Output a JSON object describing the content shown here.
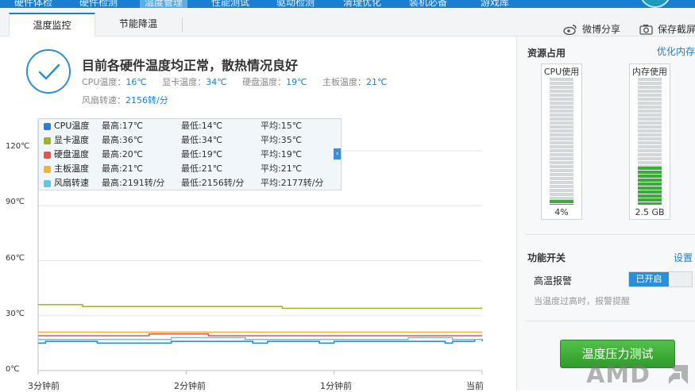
{
  "top_nav": {
    "items": [
      "硬件体检",
      "硬件检测",
      "温度管理",
      "性能测试",
      "驱动检测",
      "清理优化",
      "装机必备",
      "游戏库"
    ],
    "active_index": 2
  },
  "tabs": [
    {
      "label": "温度监控",
      "active": true
    },
    {
      "label": "节能降温",
      "active": false
    }
  ],
  "share": {
    "weibo_label": "微博分享",
    "screenshot_label": "保存截屏"
  },
  "status": {
    "title": "目前各硬件温度均正常，散热情况良好",
    "cpu_label": "CPU温度：",
    "cpu_value": "16℃",
    "gpu_label": "显卡温度：",
    "gpu_value": "34℃",
    "disk_label": "硬盘温度：",
    "disk_value": "19℃",
    "board_label": "主板温度：",
    "board_value": "21℃",
    "fan_label": "风扇转速：",
    "fan_value": "2156转/分"
  },
  "chart_data": {
    "type": "line",
    "y_tick_labels": [
      "120℃",
      "90℃",
      "60℃",
      "30℃",
      "0℃"
    ],
    "ylim": [
      0,
      120
    ],
    "x_tick_labels": [
      "3分钟前",
      "2分钟前",
      "1分钟前",
      "当前"
    ],
    "xlim": [
      -3,
      0
    ],
    "grid": true,
    "legend": [
      {
        "name": "CPU温度",
        "max": "最高:17℃",
        "min": "最低:14℃",
        "avg": "平均:15℃",
        "color": "#2b7fd6"
      },
      {
        "name": "显卡温度",
        "max": "最高:36℃",
        "min": "最低:34℃",
        "avg": "平均:35℃",
        "color": "#a0b21e"
      },
      {
        "name": "硬盘温度",
        "max": "最高:20℃",
        "min": "最低:19℃",
        "avg": "平均:19℃",
        "color": "#e8514a"
      },
      {
        "name": "主板温度",
        "max": "最高:21℃",
        "min": "最低:21℃",
        "avg": "平均:21℃",
        "color": "#f2b33d"
      },
      {
        "name": "风扇转速",
        "max": "最高:2191转/分",
        "min": "最低:2156转/分",
        "avg": "平均:2177转/分",
        "color": "#5bc8ea"
      }
    ],
    "series": [
      {
        "name": "CPU温度",
        "color": "#2b7fd6",
        "points": [
          [
            -3,
            15
          ],
          [
            -2.95,
            16
          ],
          [
            -2.7,
            16
          ],
          [
            -2.6,
            15
          ],
          [
            -2.2,
            15
          ],
          [
            -2.1,
            16
          ],
          [
            -1.6,
            16
          ],
          [
            -1.55,
            15
          ],
          [
            -1.5,
            15
          ],
          [
            -1.45,
            16
          ],
          [
            -1.2,
            16
          ],
          [
            -1.1,
            15
          ],
          [
            -1.0,
            16
          ],
          [
            -0.3,
            16
          ],
          [
            -0.25,
            15
          ],
          [
            -0.2,
            16
          ],
          [
            -0.1,
            16
          ],
          [
            -0.05,
            17
          ],
          [
            0,
            16
          ]
        ]
      },
      {
        "name": "显卡温度",
        "color": "#a0b21e",
        "points": [
          [
            -3,
            36
          ],
          [
            -2.75,
            36
          ],
          [
            -2.7,
            35
          ],
          [
            -1.4,
            35
          ],
          [
            -1.35,
            34
          ],
          [
            0,
            34
          ]
        ]
      },
      {
        "name": "硬盘温度",
        "color": "#e8514a",
        "points": [
          [
            -3,
            19
          ],
          [
            -2.3,
            19
          ],
          [
            -2.25,
            20
          ],
          [
            -1.9,
            20
          ],
          [
            -1.85,
            19
          ],
          [
            0,
            19
          ]
        ]
      },
      {
        "name": "主板温度",
        "color": "#f2b33d",
        "points": [
          [
            -3,
            21
          ],
          [
            0,
            21
          ]
        ]
      },
      {
        "name": "风扇转速",
        "color": "#5bc8ea",
        "points": [
          [
            -3,
            17
          ],
          [
            -2.2,
            17
          ],
          [
            -2.1,
            18
          ],
          [
            -1.7,
            18
          ],
          [
            -1.6,
            17
          ],
          [
            -0.6,
            17
          ],
          [
            -0.5,
            18
          ],
          [
            -0.3,
            18
          ],
          [
            -0.2,
            17
          ],
          [
            0,
            17
          ]
        ]
      }
    ]
  },
  "sidebar": {
    "resource_title": "资源占用",
    "optimize_link": "优化内存",
    "cpu_meter": {
      "label": "CPU使用",
      "value": "4%",
      "fill_fraction": 0.04
    },
    "mem_meter": {
      "label": "内存使用",
      "value": "2.5 GB",
      "fill_fraction": 0.3
    },
    "feature_title": "功能开关",
    "settings_link": "设置",
    "alarm_label": "高温报警",
    "alarm_state": "已开启",
    "alarm_hint": "当温度过高时，报警提醒",
    "stress_button": "温度压力测试"
  },
  "watermark": {
    "logo_text": "AMD"
  },
  "colors": {
    "accent": "#1a7fd0",
    "button_green": "#3bab3b"
  }
}
